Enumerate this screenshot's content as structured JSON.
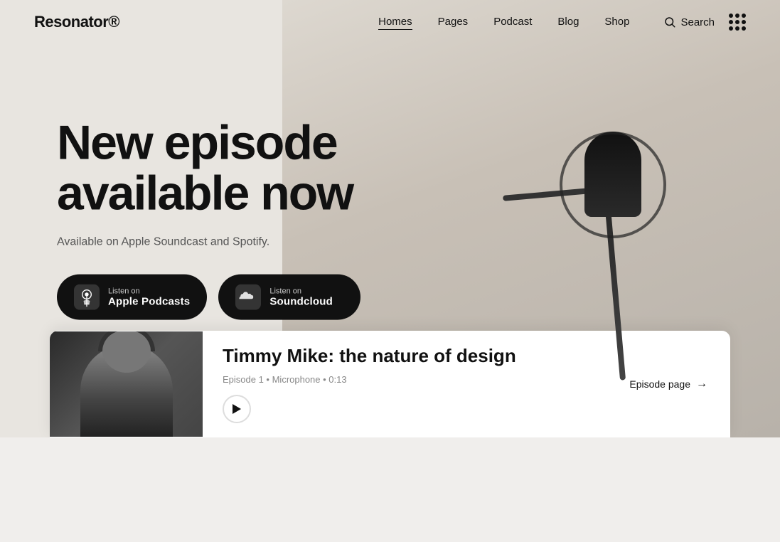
{
  "brand": {
    "logo": "Resonator®"
  },
  "nav": {
    "links": [
      {
        "label": "Homes",
        "active": true
      },
      {
        "label": "Pages",
        "active": false
      },
      {
        "label": "Podcast",
        "active": false
      },
      {
        "label": "Blog",
        "active": false
      },
      {
        "label": "Shop",
        "active": false
      }
    ],
    "search_label": "Search",
    "grid_icon": "grid-icon"
  },
  "hero": {
    "headline": "New episode available now",
    "subtext": "Available on Apple Soundcast and Spotify.",
    "cta_buttons": [
      {
        "listen_on": "Listen on",
        "platform": "Apple Podcasts",
        "icon": "apple-podcasts-icon"
      },
      {
        "listen_on": "Listen on",
        "platform": "Soundcloud",
        "icon": "soundcloud-icon"
      }
    ]
  },
  "episode_card": {
    "title": "Timmy Mike: the nature of design",
    "meta": "Episode 1 • Microphone • 0:13",
    "page_link": "Episode page"
  }
}
